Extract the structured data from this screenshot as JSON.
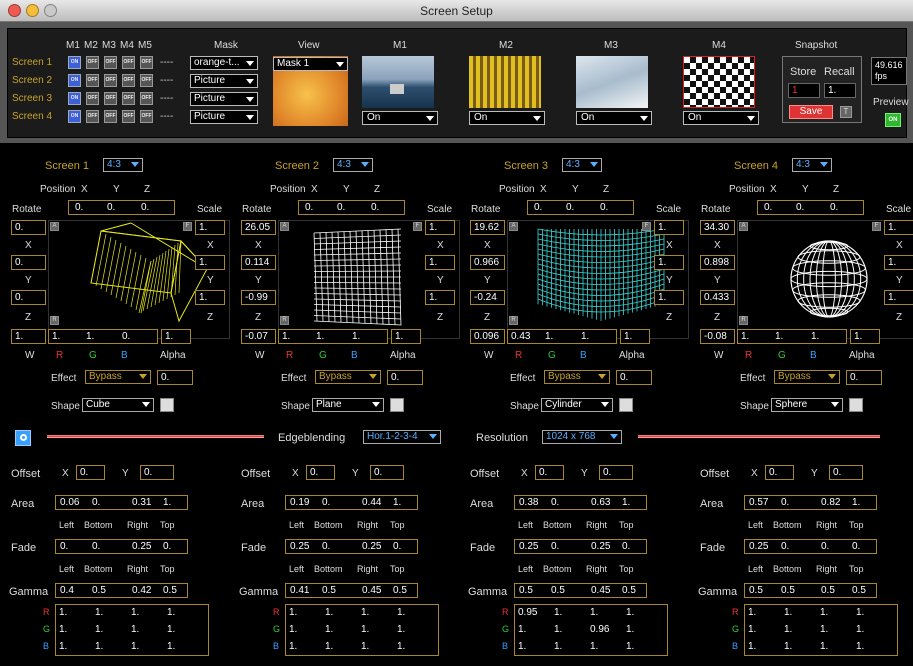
{
  "window": {
    "title": "Screen Setup"
  },
  "top": {
    "headers": {
      "m": [
        "M1",
        "M2",
        "M3",
        "M4",
        "M5"
      ],
      "mask": "Mask",
      "view": "View",
      "m1": "M1",
      "m2": "M2",
      "m3": "M3",
      "m4": "M4",
      "snapshot": "Snapshot"
    },
    "screens": [
      {
        "label": "Screen 1",
        "toggles": [
          "ON",
          "OFF",
          "OFF",
          "OFF",
          "OFF"
        ],
        "dash": "----",
        "mask": "orange-t..."
      },
      {
        "label": "Screen 2",
        "toggles": [
          "ON",
          "OFF",
          "OFF",
          "OFF",
          "OFF"
        ],
        "dash": "----",
        "mask": "Picture"
      },
      {
        "label": "Screen 3",
        "toggles": [
          "ON",
          "OFF",
          "OFF",
          "OFF",
          "OFF"
        ],
        "dash": "----",
        "mask": "Picture"
      },
      {
        "label": "Screen 4",
        "toggles": [
          "ON",
          "OFF",
          "OFF",
          "OFF",
          "OFF"
        ],
        "dash": "----",
        "mask": "Picture"
      }
    ],
    "view_mask": "Mask 1",
    "m_states": [
      "On",
      "On",
      "On",
      "On"
    ],
    "snapshot": {
      "store": "Store",
      "recall": "Recall",
      "store_value": "1",
      "recall_value": "1.",
      "save": "Save",
      "small": "T"
    },
    "fps": {
      "value": "49.616",
      "unit": "fps"
    },
    "preview": {
      "label": "Preview",
      "state": "ON"
    }
  },
  "common": {
    "position": "Position",
    "x": "X",
    "y": "Y",
    "z": "Z",
    "rotate": "Rotate",
    "scale": "Scale",
    "w": "W",
    "r": "R",
    "g": "G",
    "b": "B",
    "alpha": "Alpha",
    "effect": "Effect",
    "shape": "Shape",
    "offset": "Offset",
    "area": "Area",
    "fade": "Fade",
    "gamma": "Gamma",
    "left": "Left",
    "bottom": "Bottom",
    "right": "Right",
    "top": "Top",
    "a_tag": "A",
    "f_tag": "F",
    "r_tag": "R"
  },
  "screens": [
    {
      "title": "Screen 1",
      "aspect": "4:3",
      "position": [
        "0.",
        "0.",
        "0."
      ],
      "rot_z": "0.",
      "rot_x": "0.",
      "rot_y": "0.",
      "rot_z2": "1.",
      "scale": [
        "1.",
        "1.",
        "1."
      ],
      "color": [
        "1.",
        "1.",
        "0."
      ],
      "alpha": "1.",
      "effect": "Bypass",
      "effect_val": "0.",
      "shape": "Cube",
      "offset": [
        "0.",
        "0."
      ],
      "area": [
        "0.06",
        "0.",
        "0.31",
        "1."
      ],
      "fade": [
        "0.",
        "0.",
        "0.25",
        "0."
      ],
      "gamma": [
        "0.4",
        "0.5",
        "0.42",
        "0.5"
      ],
      "rgb": [
        [
          "1.",
          "1.",
          "1.",
          "1."
        ],
        [
          "1.",
          "1.",
          "1.",
          "1."
        ],
        [
          "1.",
          "1.",
          "1.",
          "1."
        ]
      ]
    },
    {
      "title": "Screen 2",
      "aspect": "4:3",
      "position": [
        "0.",
        "0.",
        "0."
      ],
      "rot_z": "26.05",
      "rot_x": "0.114",
      "rot_y": "-0.99",
      "rot_z2": "-0.07",
      "scale": [
        "1.",
        "1.",
        "1."
      ],
      "color": [
        "1.",
        "1.",
        "1."
      ],
      "alpha": "1.",
      "effect": "Bypass",
      "effect_val": "0.",
      "shape": "Plane",
      "offset": [
        "0.",
        "0."
      ],
      "area": [
        "0.19",
        "0.",
        "0.44",
        "1."
      ],
      "fade": [
        "0.25",
        "0.",
        "0.25",
        "0."
      ],
      "gamma": [
        "0.41",
        "0.5",
        "0.45",
        "0.5"
      ],
      "rgb": [
        [
          "1.",
          "1.",
          "1.",
          "1."
        ],
        [
          "1.",
          "1.",
          "1.",
          "1."
        ],
        [
          "1.",
          "1.",
          "1.",
          "1."
        ]
      ]
    },
    {
      "title": "Screen 3",
      "aspect": "4:3",
      "position": [
        "0.",
        "0.",
        "0."
      ],
      "rot_z": "19.62",
      "rot_x": "0.966",
      "rot_y": "-0.24",
      "rot_z2": "0.096",
      "scale": [
        "1.",
        "1.",
        "1."
      ],
      "color": [
        "0.43",
        "1.",
        "1."
      ],
      "alpha": "1.",
      "effect": "Bypass",
      "effect_val": "0.",
      "shape": "Cylinder",
      "offset": [
        "0.",
        "0."
      ],
      "area": [
        "0.38",
        "0.",
        "0.63",
        "1."
      ],
      "fade": [
        "0.25",
        "0.",
        "0.25",
        "0."
      ],
      "gamma": [
        "0.5",
        "0.5",
        "0.45",
        "0.5"
      ],
      "rgb": [
        [
          "0.95",
          "1.",
          "1.",
          "1."
        ],
        [
          "1.",
          "1.",
          "0.96",
          "1."
        ],
        [
          "1.",
          "1.",
          "1.",
          "1."
        ]
      ]
    },
    {
      "title": "Screen 4",
      "aspect": "4:3",
      "position": [
        "0.",
        "0.",
        "0."
      ],
      "rot_z": "34.30",
      "rot_x": "0.898",
      "rot_y": "0.433",
      "rot_z2": "-0.08",
      "scale": [
        "1.",
        "1.",
        "1."
      ],
      "color": [
        "1.",
        "1.",
        "1."
      ],
      "alpha": "1.",
      "effect": "Bypass",
      "effect_val": "0.",
      "shape": "Sphere",
      "offset": [
        "0.",
        "0."
      ],
      "area": [
        "0.57",
        "0.",
        "0.82",
        "1."
      ],
      "fade": [
        "0.25",
        "0.",
        "0.",
        "0."
      ],
      "gamma": [
        "0.5",
        "0.5",
        "0.5",
        "0.5"
      ],
      "rgb": [
        [
          "1.",
          "1.",
          "1.",
          "1."
        ],
        [
          "1.",
          "1.",
          "1.",
          "1."
        ],
        [
          "1.",
          "1.",
          "1.",
          "1."
        ]
      ]
    }
  ],
  "middle": {
    "edgeblending": "Edgeblending",
    "edge_value": "Hor.1-2-3-4",
    "resolution": "Resolution",
    "res_value": "1024 x 768"
  },
  "colors": {
    "accent_gold": "#c7a229",
    "toggle_on": "#3d5fd9",
    "red": "#e04040",
    "blue": "#3aa0ff",
    "preview_on": "#2db82d"
  }
}
